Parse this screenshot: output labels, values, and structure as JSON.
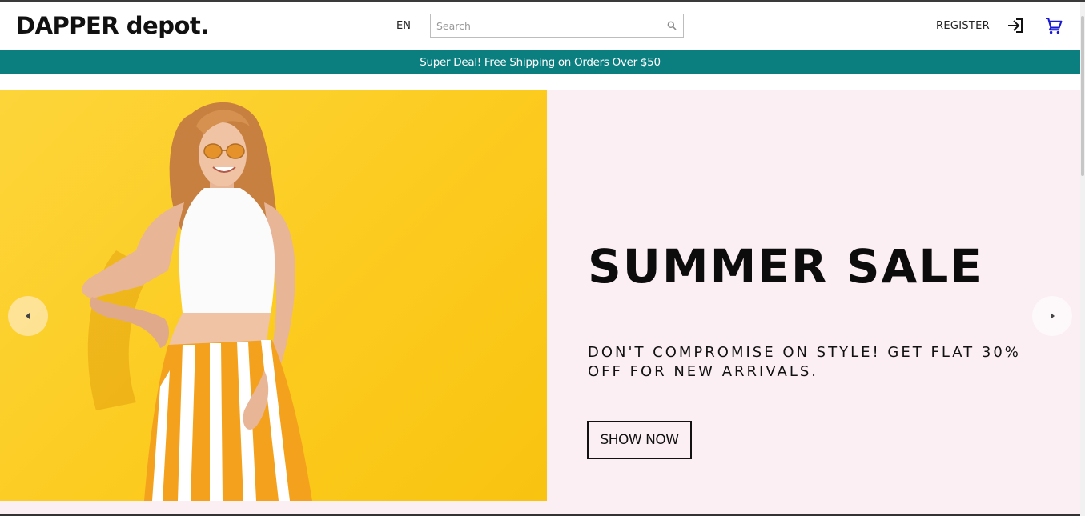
{
  "header": {
    "logo": "DAPPER depot.",
    "language": "EN",
    "search_placeholder": "Search",
    "register_label": "REGISTER",
    "icons": [
      "search-icon",
      "login-icon",
      "cart-icon"
    ]
  },
  "announcement": {
    "text": "Super Deal! Free Shipping on Orders Over $50"
  },
  "hero": {
    "title": "SUMMER SALE",
    "description": "DON'T COMPROMISE ON STYLE! GET FLAT 30% OFF FOR NEW ARRIVALS.",
    "button_label": "SHOW NOW",
    "image_alt": "woman in white crop top and orange striped trousers on yellow background"
  },
  "colors": {
    "announcement_bg": "#0b7e80",
    "hero_bg": "#fbeff3",
    "image_bg": "#fccb1f",
    "cart_icon": "#1a1ad6"
  }
}
